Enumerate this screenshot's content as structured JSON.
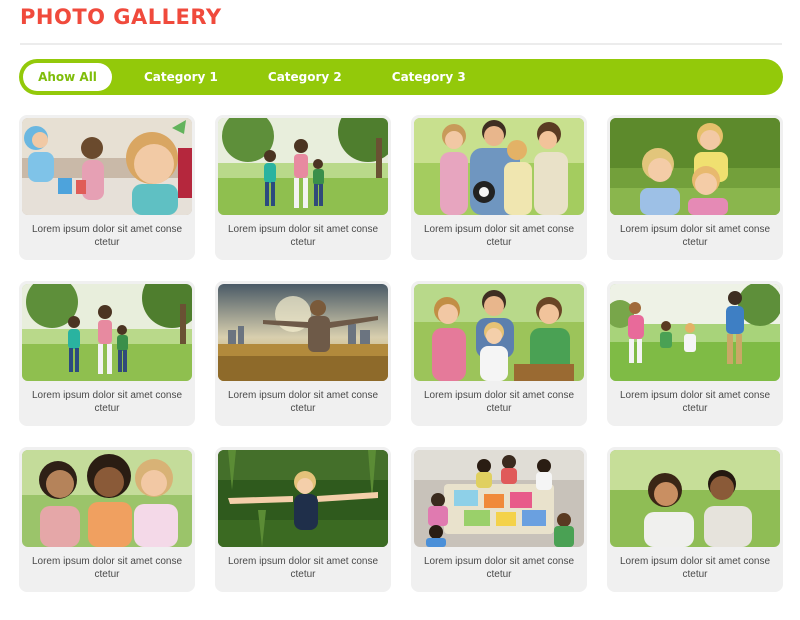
{
  "page": {
    "title": "PHOTO GALLERY"
  },
  "tabs": [
    {
      "label": "Ahow All",
      "active": true
    },
    {
      "label": "Category 1",
      "active": false
    },
    {
      "label": "Category 2",
      "active": false
    },
    {
      "label": "Category 3",
      "active": false
    }
  ],
  "photos": [
    {
      "subject": "children-party",
      "caption": "Lorem ipsum dolor sit amet conse ctetur"
    },
    {
      "subject": "family-walk-park",
      "caption": "Lorem ipsum dolor sit amet conse ctetur"
    },
    {
      "subject": "family-with-ball",
      "caption": "Lorem ipsum dolor sit amet conse ctetur"
    },
    {
      "subject": "kids-on-grass",
      "caption": "Lorem ipsum dolor sit amet conse ctetur"
    },
    {
      "subject": "family-walk-park",
      "caption": "Lorem ipsum dolor sit amet conse ctetur"
    },
    {
      "subject": "man-arms-out-city",
      "caption": "Lorem ipsum dolor sit amet conse ctetur"
    },
    {
      "subject": "family-portrait-field",
      "caption": "Lorem ipsum dolor sit amet conse ctetur"
    },
    {
      "subject": "family-running",
      "caption": "Lorem ipsum dolor sit amet conse ctetur"
    },
    {
      "subject": "three-girls-smiling",
      "caption": "Lorem ipsum dolor sit amet conse ctetur"
    },
    {
      "subject": "child-arms-out-grass",
      "caption": "Lorem ipsum dolor sit amet conse ctetur"
    },
    {
      "subject": "kids-crafting-table",
      "caption": "Lorem ipsum dolor sit amet conse ctetur"
    },
    {
      "subject": "two-kids-lying-grass",
      "caption": "Lorem ipsum dolor sit amet conse ctetur"
    }
  ],
  "colors": {
    "title": "#f04a3c",
    "tabbar": "#93c90a",
    "active_tab_text": "#7fbd0a",
    "card": "#f0f0f0",
    "caption": "#4a4a4a"
  }
}
